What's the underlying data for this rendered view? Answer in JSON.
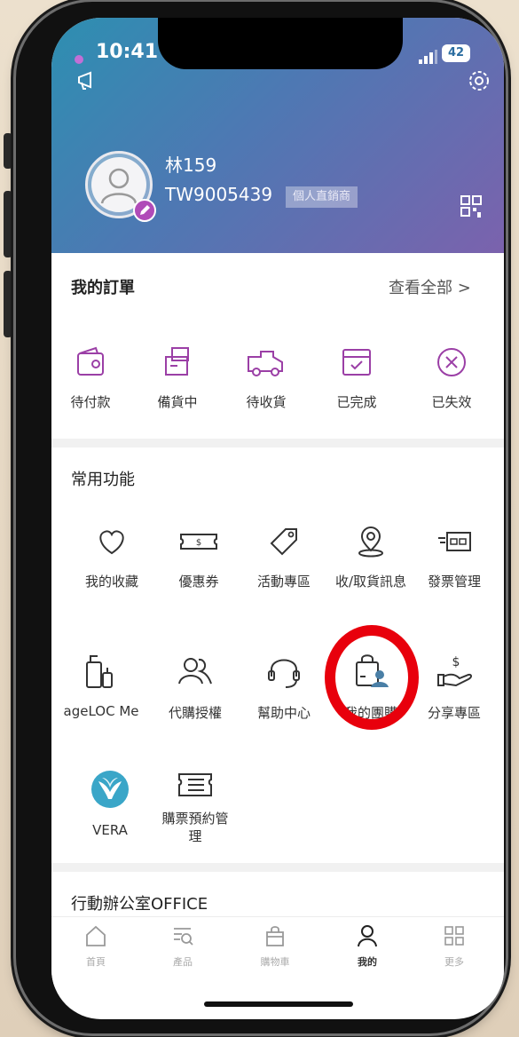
{
  "status_bar": {
    "time": "10:41",
    "battery": "42"
  },
  "profile": {
    "name": "林159",
    "member_id": "TW9005439",
    "member_type": "個人直銷商"
  },
  "orders": {
    "title": "我的訂單",
    "see_all": "查看全部 >",
    "items": [
      {
        "label": "待付款",
        "icon": "wallet-icon"
      },
      {
        "label": "備貨中",
        "icon": "boxes-icon"
      },
      {
        "label": "待收貨",
        "icon": "truck-icon"
      },
      {
        "label": "已完成",
        "icon": "box-check-icon"
      },
      {
        "label": "已失效",
        "icon": "cancel-circle-icon"
      }
    ]
  },
  "functions": {
    "title": "常用功能",
    "items": [
      {
        "label": "我的收藏",
        "icon": "heart-icon"
      },
      {
        "label": "優惠券",
        "icon": "coupon-icon"
      },
      {
        "label": "活動專區",
        "icon": "tag-icon"
      },
      {
        "label": "收/取貨訊息",
        "icon": "location-pin-icon"
      },
      {
        "label": "發票管理",
        "icon": "invoice-icon"
      },
      {
        "label": "ageLOC Me",
        "icon": "bottles-icon"
      },
      {
        "label": "代購授權",
        "icon": "users-icon"
      },
      {
        "label": "幫助中心",
        "icon": "headset-icon"
      },
      {
        "label": "我的團購",
        "icon": "group-buy-icon"
      },
      {
        "label": "分享專區",
        "icon": "share-money-icon"
      },
      {
        "label": "VERA",
        "icon": "vera-logo-icon"
      },
      {
        "label": "購票預約管理",
        "label_line1": "購票預約管",
        "label_line2": "理",
        "icon": "ticket-list-icon"
      }
    ]
  },
  "office": {
    "title": "行動辦公室OFFICE"
  },
  "tabbar": {
    "items": [
      {
        "label": "首頁",
        "icon": "home-icon"
      },
      {
        "label": "產品",
        "icon": "product-search-icon"
      },
      {
        "label": "購物車",
        "icon": "shopping-bag-icon"
      },
      {
        "label": "我的",
        "icon": "person-icon",
        "active": true
      },
      {
        "label": "更多",
        "icon": "grid-icon"
      }
    ]
  },
  "colors": {
    "accent": "#b04bb8",
    "header_start": "#2d8fb1",
    "header_end": "#7b62ad",
    "annotation": "#e8000c",
    "icon": "#9b3fa6"
  }
}
